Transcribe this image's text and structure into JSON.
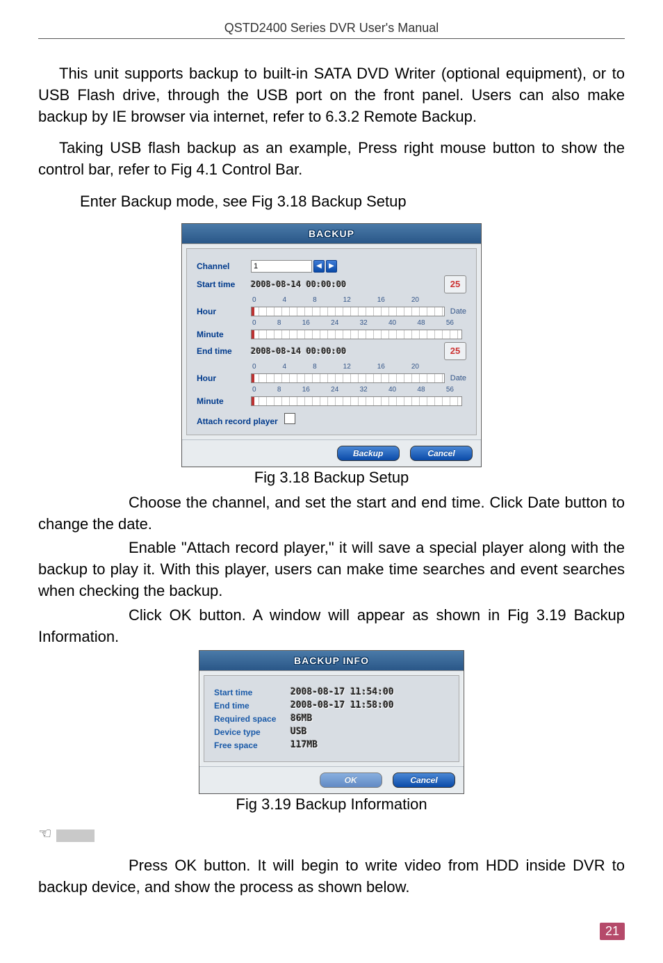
{
  "header": "QSTD2400 Series DVR User's Manual",
  "para1": "This unit supports backup to built-in SATA DVD Writer (optional equipment), or to USB Flash drive, through the USB port on the front panel. Users can also make backup by IE browser via internet, refer to 6.3.2 Remote Backup.",
  "para2": "Taking USB flash backup as an example, Press right mouse button to show the control bar, refer to Fig 4.1 Control Bar.",
  "enter_line": "Enter Backup mode, see Fig 3.18    Backup Setup",
  "fig318_caption": "Fig 3.18    Backup Setup",
  "para3a": "Choose the channel, and set the start and end time. Click Date button to change the date.",
  "para3b": "Enable \"Attach record player,\" it will save a special player along with the backup to play it. With this player, users can make time searches and event searches when checking the backup.",
  "para3c": "Click OK button. A window will appear as shown in Fig 3.19 Backup Information.",
  "fig319_caption": "Fig 3.19    Backup Information",
  "para4": "Press OK button. It will begin to write video from HDD inside DVR to backup device, and show the process as shown below.",
  "page_number": "21",
  "backup_dialog": {
    "title": "BACKUP",
    "channel_label": "Channel",
    "channel_value": "1",
    "start_label": "Start time",
    "start_value": "2008-08-14 00:00:00",
    "end_label": "End time",
    "end_value": "2008-08-14 00:00:00",
    "hour_label": "Hour",
    "minute_label": "Minute",
    "date_btn_num": "25",
    "date_label": "Date",
    "hour_ticks": [
      "0",
      "4",
      "8",
      "12",
      "16",
      "20"
    ],
    "minute_ticks": [
      "0",
      "8",
      "16",
      "24",
      "32",
      "40",
      "48",
      "56"
    ],
    "attach_label": "Attach record player",
    "backup_btn": "Backup",
    "cancel_btn": "Cancel"
  },
  "info_dialog": {
    "title": "BACKUP INFO",
    "start_label": "Start time",
    "start_value": "2008-08-17 11:54:00",
    "end_label": "End time",
    "end_value": "2008-08-17 11:58:00",
    "req_label": "Required space",
    "req_value": "86MB",
    "dev_label": "Device type",
    "dev_value": "USB",
    "free_label": "Free space",
    "free_value": "117MB",
    "ok_btn": "OK",
    "cancel_btn": "Cancel"
  }
}
